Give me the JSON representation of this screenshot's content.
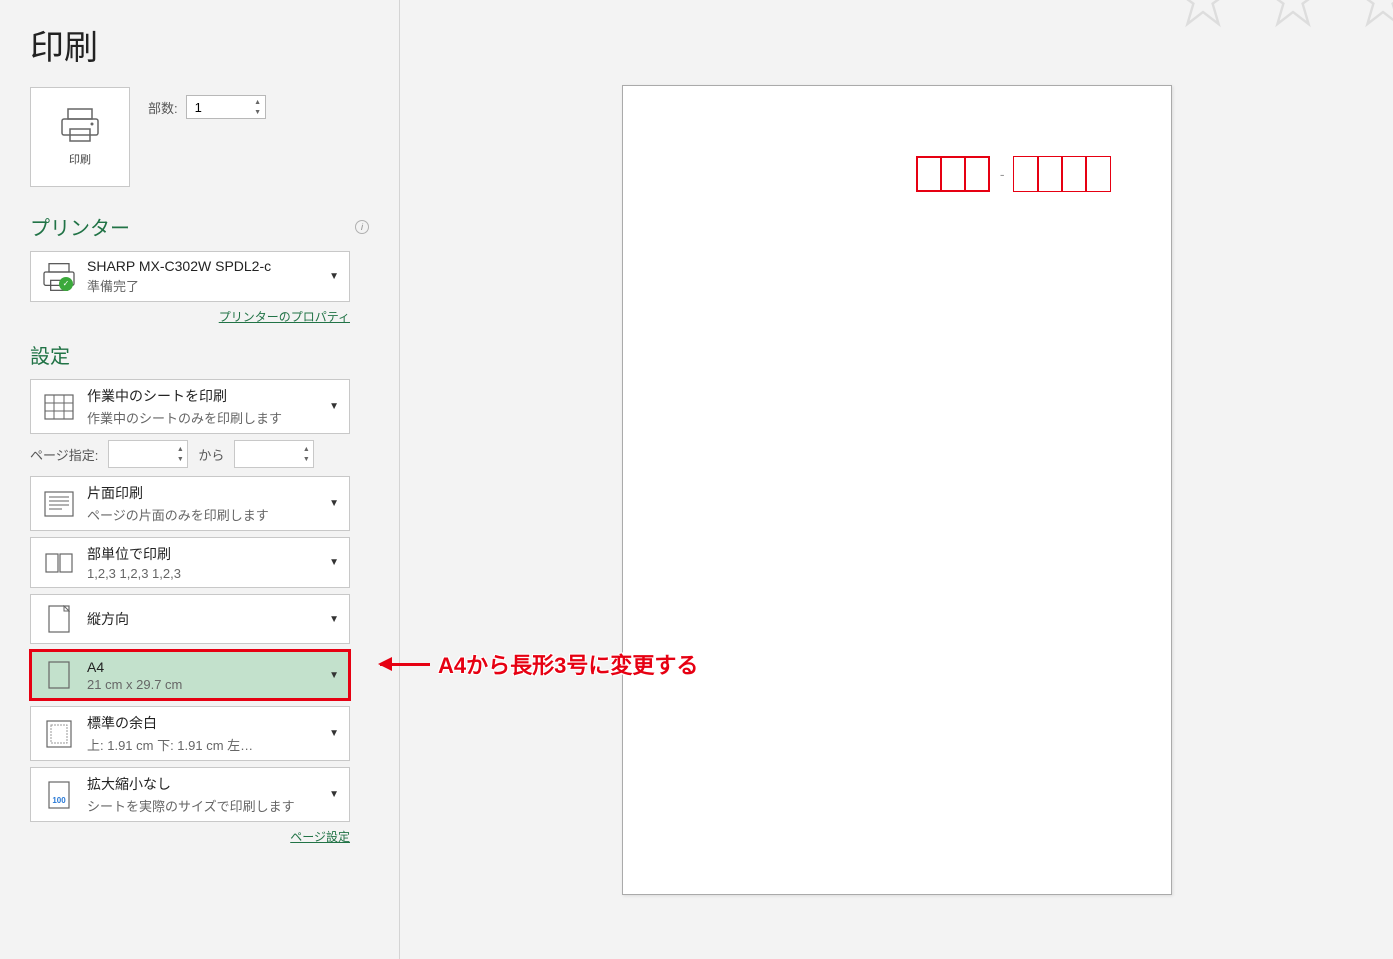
{
  "page_title": "印刷",
  "print_button_label": "印刷",
  "copies": {
    "label": "部数:",
    "value": "1"
  },
  "printer": {
    "header": "プリンター",
    "name": "SHARP MX-C302W SPDL2-c",
    "status": "準備完了",
    "properties_link": "プリンターのプロパティ"
  },
  "settings": {
    "header": "設定",
    "page_range_label": "ページ指定:",
    "page_range_to": "から",
    "print_what": {
      "title": "作業中のシートを印刷",
      "sub": "作業中のシートのみを印刷します"
    },
    "sides": {
      "title": "片面印刷",
      "sub": "ページの片面のみを印刷します"
    },
    "collate": {
      "title": "部単位で印刷",
      "sub": "1,2,3    1,2,3    1,2,3"
    },
    "orientation": {
      "title": "縦方向"
    },
    "paper_size": {
      "title": "A4",
      "sub": "21 cm x 29.7 cm"
    },
    "margins": {
      "title": "標準の余白",
      "sub": "上: 1.91 cm 下: 1.91 cm 左…"
    },
    "scaling": {
      "title": "拡大縮小なし",
      "sub": "シートを実際のサイズで印刷します"
    },
    "page_setup_link": "ページ設定"
  },
  "annotation": {
    "text": "A4から長形3号に変更する"
  }
}
